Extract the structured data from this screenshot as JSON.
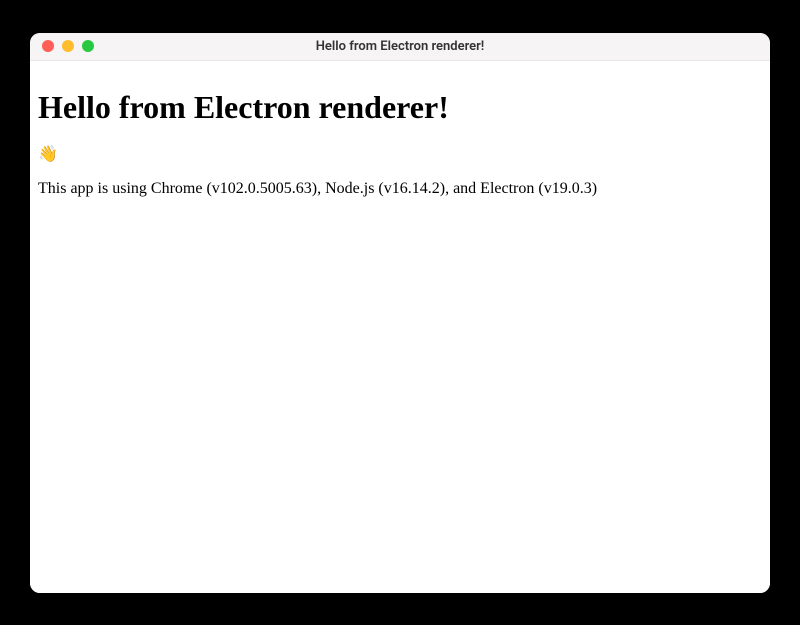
{
  "window": {
    "title": "Hello from Electron renderer!"
  },
  "content": {
    "heading": "Hello from Electron renderer!",
    "emoji": "👋",
    "version_text": "This app is using Chrome (v102.0.5005.63), Node.js (v16.14.2), and Electron (v19.0.3)"
  }
}
